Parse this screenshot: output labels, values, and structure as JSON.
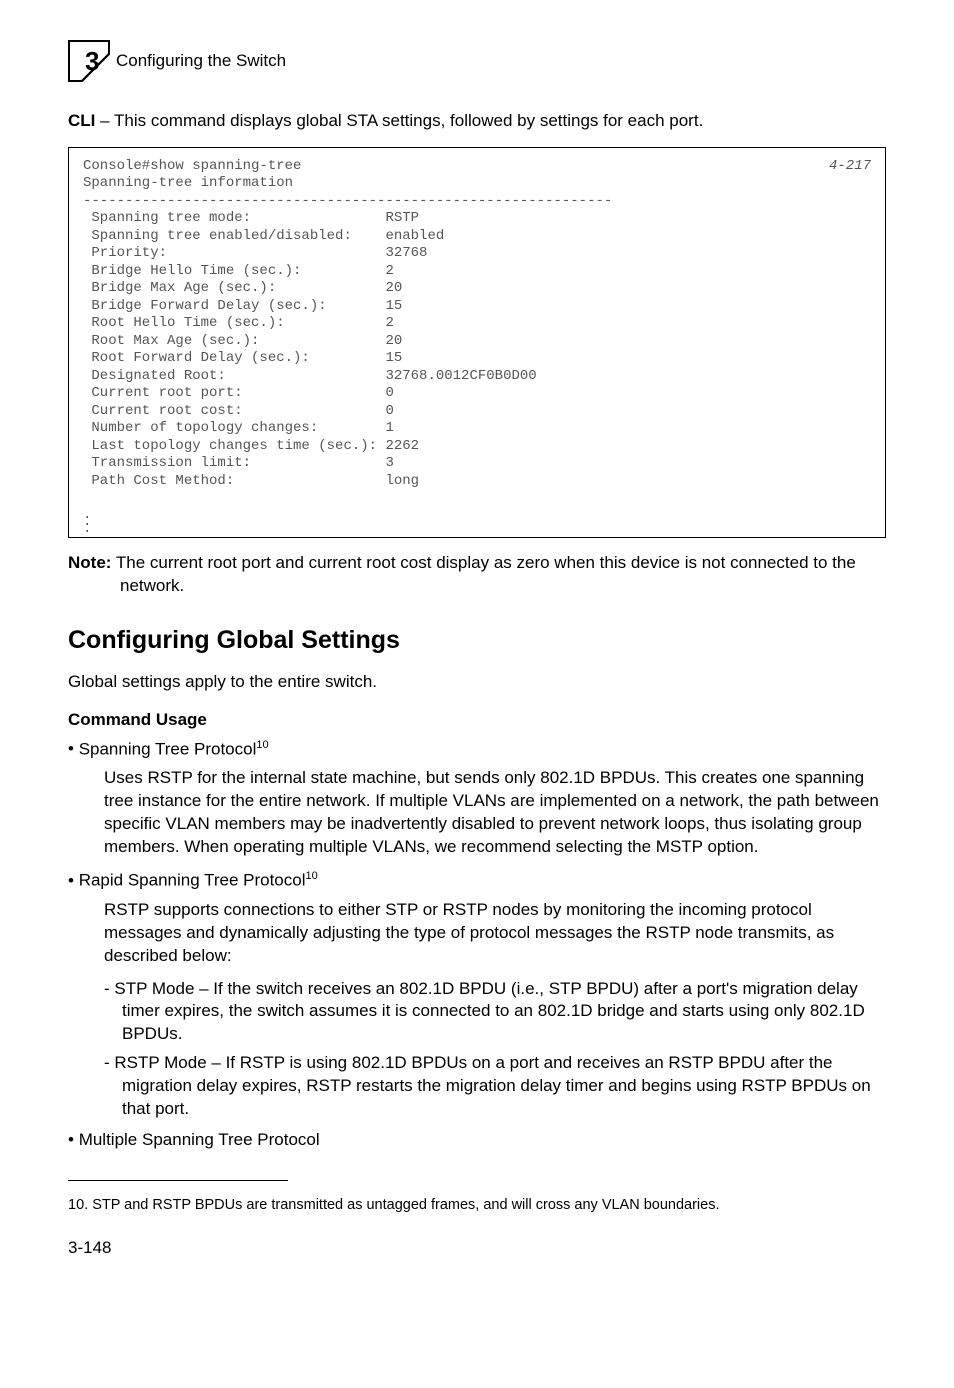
{
  "header": {
    "chapter_number": "3",
    "title": "Configuring the Switch"
  },
  "intro": {
    "cli_label": "CLI",
    "cli_text": " – This command displays global STA settings, followed by settings for each port."
  },
  "code": {
    "page_ref": "4-217",
    "line1": "Console#show spanning-tree",
    "line2": "Spanning-tree information",
    "dashes": "---------------------------------------------------------------",
    "rows": [
      [
        " Spanning tree mode:",
        "RSTP"
      ],
      [
        " Spanning tree enabled/disabled:",
        "enabled"
      ],
      [
        " Priority:",
        "32768"
      ],
      [
        " Bridge Hello Time (sec.):",
        "2"
      ],
      [
        " Bridge Max Age (sec.):",
        "20"
      ],
      [
        " Bridge Forward Delay (sec.):",
        "15"
      ],
      [
        " Root Hello Time (sec.):",
        "2"
      ],
      [
        " Root Max Age (sec.):",
        "20"
      ],
      [
        " Root Forward Delay (sec.):",
        "15"
      ],
      [
        " Designated Root:",
        "32768.0012CF0B0D00"
      ],
      [
        " Current root port:",
        "0"
      ],
      [
        " Current root cost:",
        "0"
      ],
      [
        " Number of topology changes:",
        "1"
      ],
      [
        " Last topology changes time (sec.):",
        "2262"
      ],
      [
        " Transmission limit:",
        "3"
      ],
      [
        " Path Cost Method:",
        "long"
      ]
    ]
  },
  "note": {
    "label": "Note:",
    "text": "The current root port and current root cost display as zero when this device is not connected to the network."
  },
  "section": {
    "heading": "Configuring Global Settings",
    "intro": "Global settings apply to the entire switch.",
    "command_usage_label": "Command Usage"
  },
  "bullets": {
    "b1_title": "Spanning Tree Protocol",
    "b1_sup": "10",
    "b1_body": "Uses RSTP for the internal state machine, but sends only 802.1D BPDUs. This creates one spanning tree instance for the entire network. If multiple VLANs are implemented on a network, the path between specific VLAN members may be inadvertently disabled to prevent network loops, thus isolating group members. When operating multiple VLANs, we recommend selecting the MSTP option.",
    "b2_title": "Rapid Spanning Tree Protocol",
    "b2_sup": "10",
    "b2_body": "RSTP supports connections to either STP or RSTP nodes by monitoring the incoming protocol messages and dynamically adjusting the type of protocol messages the RSTP node transmits, as described below:",
    "b2_sub1": "STP Mode – If the switch receives an 802.1D BPDU (i.e., STP BPDU) after a port's migration delay timer expires, the switch assumes it is connected to an 802.1D bridge and starts using only 802.1D BPDUs.",
    "b2_sub2": "RSTP Mode – If RSTP is using 802.1D BPDUs on a port and receives an RSTP BPDU after the migration delay expires, RSTP restarts the migration delay timer and begins using RSTP BPDUs on that port.",
    "b3_title": "Multiple Spanning Tree Protocol"
  },
  "footnote": {
    "num": "10.",
    "text": "STP and RSTP BPDUs are transmitted as untagged frames, and will cross any VLAN boundaries."
  },
  "page_number": "3-148"
}
